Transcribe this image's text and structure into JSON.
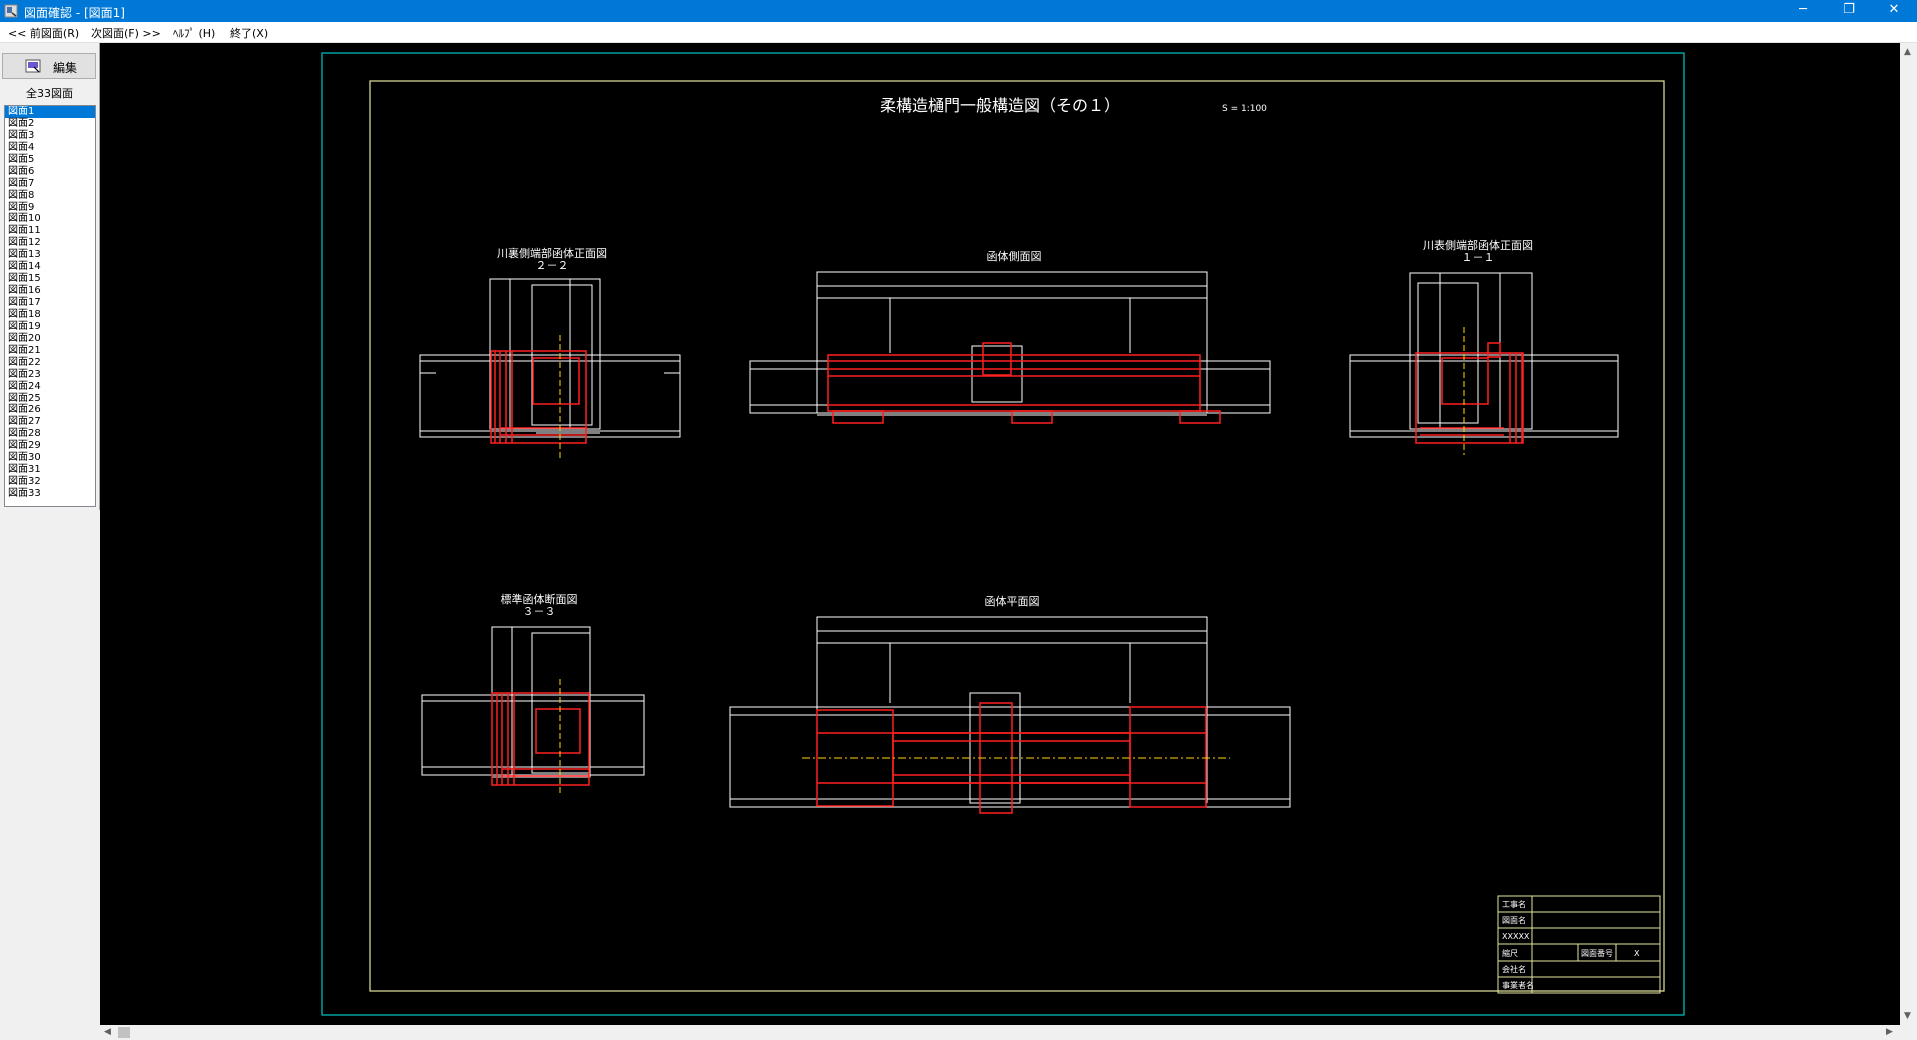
{
  "window": {
    "title": "図面確認 - [図面1]",
    "minimize": "─",
    "restore": "❐",
    "close": "✕"
  },
  "menu": {
    "prev": "<< 前図面(R)",
    "next": "次図面(F) >>",
    "help": "ﾍﾙﾌﾟ (H)",
    "exit": "終了(X)"
  },
  "sidebar": {
    "edit_label": "編集",
    "count_label": "全33図面",
    "items": [
      "図面1",
      "図面2",
      "図面3",
      "図面4",
      "図面5",
      "図面6",
      "図面7",
      "図面8",
      "図面9",
      "図面10",
      "図面11",
      "図面12",
      "図面13",
      "図面14",
      "図面15",
      "図面16",
      "図面17",
      "図面18",
      "図面19",
      "図面20",
      "図面21",
      "図面22",
      "図面23",
      "図面24",
      "図面25",
      "図面26",
      "図面27",
      "図面28",
      "図面29",
      "図面30",
      "図面31",
      "図面32",
      "図面33"
    ],
    "selected_index": 0
  },
  "drawing": {
    "title": "柔構造樋門一般構造図（その１）",
    "scale": "S = 1:100",
    "views": [
      {
        "name": "川裏側端部函体正面図",
        "section": "２－２"
      },
      {
        "name": "函体側面図",
        "section": ""
      },
      {
        "name": "川表側端部函体正面図",
        "section": "１－１"
      },
      {
        "name": "標準函体断面図",
        "section": "３－３"
      },
      {
        "name": "函体平面図",
        "section": ""
      }
    ],
    "title_block": {
      "row1": "工事名",
      "row2": "図面名",
      "row3": "XXXXX",
      "row4": "縮尺",
      "row4_mid": "図面番号",
      "row4_right": "X",
      "row5": "会社名",
      "row6": "事業者名"
    }
  },
  "colors": {
    "titlebar": "#0078d7",
    "canvas": "#000000",
    "outer_border": "#00c8c8",
    "inner_border": "#e6e6a0",
    "structure": "#ff2020",
    "centerline": "#ffd700"
  }
}
